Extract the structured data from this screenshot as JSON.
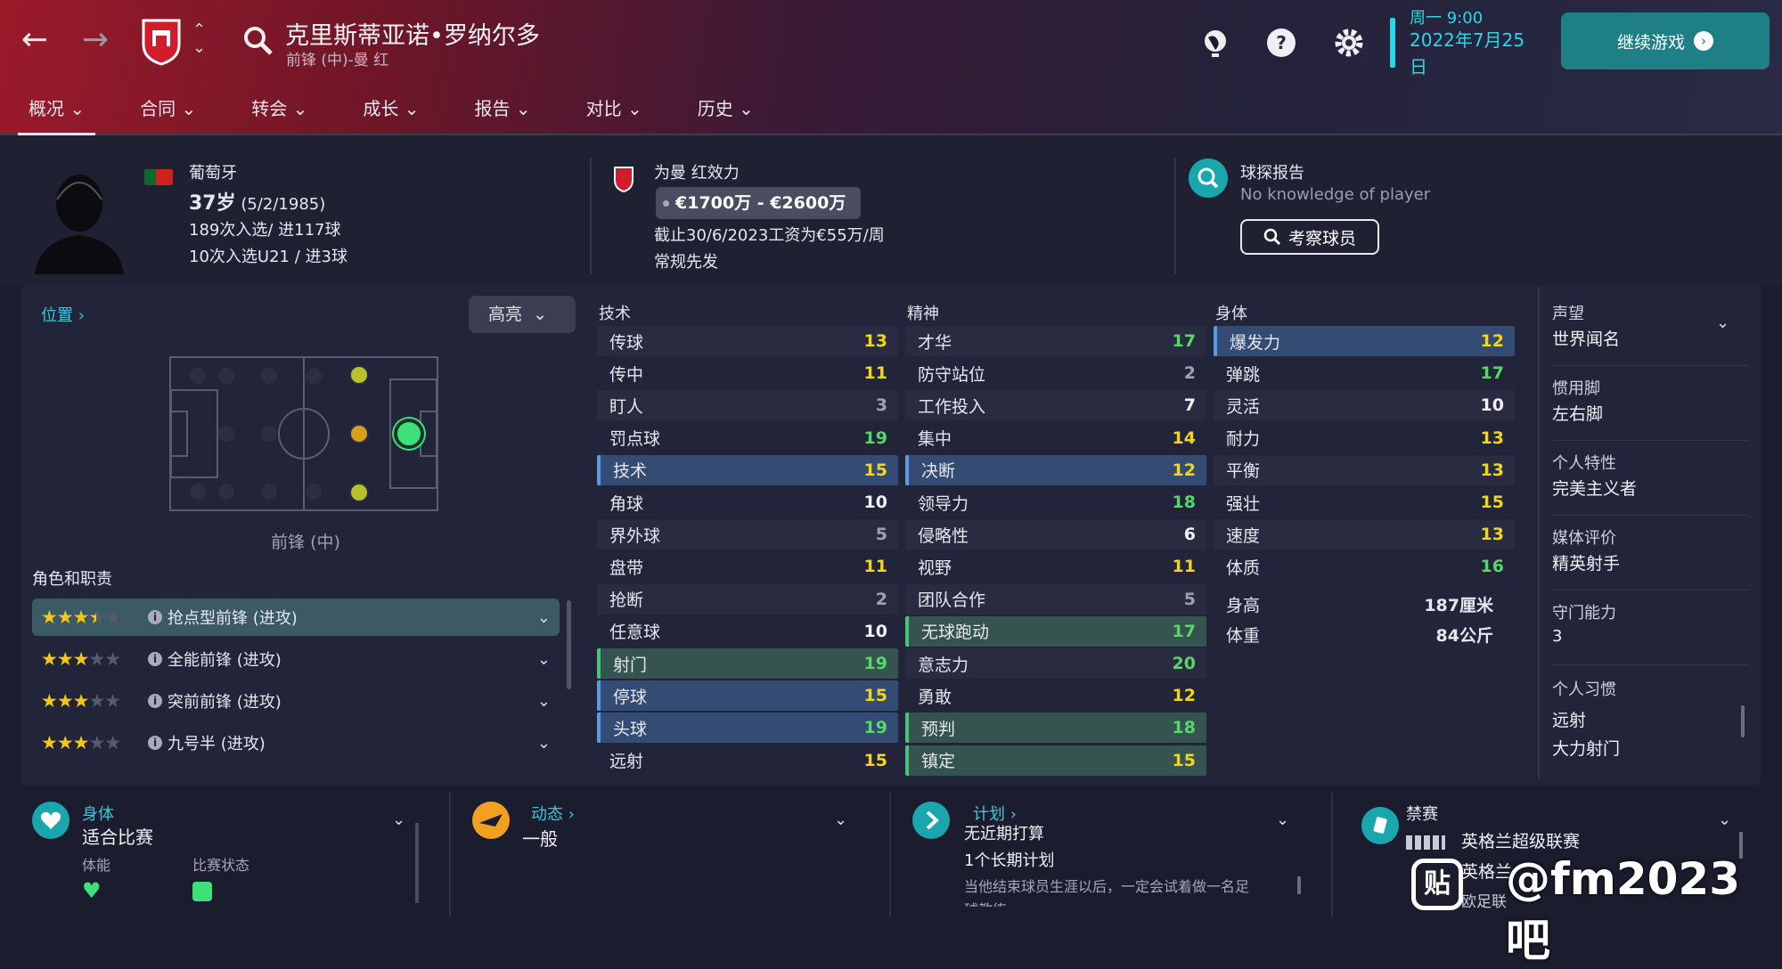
{
  "header": {
    "player_name": "克里斯蒂亚诺•罗纳尔多",
    "position_club": "前锋 (中)-曼 红",
    "weekday_time": "周一 9:00",
    "date": "2022年7月25日",
    "continue_label": "继续游戏",
    "tabs": [
      "概况",
      "合同",
      "转会",
      "成长",
      "报告",
      "对比",
      "历史"
    ]
  },
  "profile": {
    "nationality": "葡萄牙",
    "age": "37岁",
    "dob": "(5/2/1985)",
    "caps": "189次入选/ 进117球",
    "u21": "10次入选U21 / 进3球",
    "club_label": "为曼 红效力",
    "value": "€1700万 - €2600万",
    "contract": "截止30/6/2023工资为€55万/周",
    "squad_status": "常规先发",
    "scout_title": "球探报告",
    "scout_text": "No knowledge of player",
    "scout_button": "考察球员"
  },
  "position": {
    "link": "位置",
    "highlight": "高亮",
    "name": "前锋 (中)",
    "roles_title": "角色和职责",
    "roles": [
      {
        "stars": 3.5,
        "label": "抢点型前锋 (进攻)"
      },
      {
        "stars": 3,
        "label": "全能前锋 (进攻)"
      },
      {
        "stars": 3,
        "label": "突前前锋 (进攻)"
      },
      {
        "stars": 3,
        "label": "九号半 (进攻)"
      }
    ]
  },
  "attributes": {
    "technical_title": "技术",
    "mental_title": "精神",
    "physical_title": "身体",
    "technical": [
      {
        "n": "传球",
        "v": 13
      },
      {
        "n": "传中",
        "v": 11
      },
      {
        "n": "盯人",
        "v": 3
      },
      {
        "n": "罚点球",
        "v": 19
      },
      {
        "n": "技术",
        "v": 15
      },
      {
        "n": "角球",
        "v": 10
      },
      {
        "n": "界外球",
        "v": 5
      },
      {
        "n": "盘带",
        "v": 11
      },
      {
        "n": "抢断",
        "v": 2
      },
      {
        "n": "任意球",
        "v": 10
      },
      {
        "n": "射门",
        "v": 19
      },
      {
        "n": "停球",
        "v": 15
      },
      {
        "n": "头球",
        "v": 19
      },
      {
        "n": "远射",
        "v": 15
      }
    ],
    "mental": [
      {
        "n": "才华",
        "v": 17
      },
      {
        "n": "防守站位",
        "v": 2
      },
      {
        "n": "工作投入",
        "v": 7
      },
      {
        "n": "集中",
        "v": 14
      },
      {
        "n": "决断",
        "v": 12
      },
      {
        "n": "领导力",
        "v": 18
      },
      {
        "n": "侵略性",
        "v": 6
      },
      {
        "n": "视野",
        "v": 11
      },
      {
        "n": "团队合作",
        "v": 5
      },
      {
        "n": "无球跑动",
        "v": 17
      },
      {
        "n": "意志力",
        "v": 20
      },
      {
        "n": "勇敢",
        "v": 12
      },
      {
        "n": "预判",
        "v": 18
      },
      {
        "n": "镇定",
        "v": 15
      }
    ],
    "physical": [
      {
        "n": "爆发力",
        "v": 12
      },
      {
        "n": "弹跳",
        "v": 17
      },
      {
        "n": "灵活",
        "v": 10
      },
      {
        "n": "耐力",
        "v": 13
      },
      {
        "n": "平衡",
        "v": 13
      },
      {
        "n": "强壮",
        "v": 15
      },
      {
        "n": "速度",
        "v": 13
      },
      {
        "n": "体质",
        "v": 16
      }
    ],
    "height_label": "身高",
    "height": "187厘米",
    "weight_label": "体重",
    "weight": "84公斤"
  },
  "side": {
    "reputation_label": "声望",
    "reputation": "世界闻名",
    "foot_label": "惯用脚",
    "foot": "左右脚",
    "personality_label": "个人特性",
    "personality": "完美主义者",
    "media_label": "媒体评价",
    "media": "精英射手",
    "gk_label": "守门能力",
    "gk": "3",
    "habits_label": "个人习惯",
    "habit1": "远射",
    "habit2": "大力射门"
  },
  "bottom": {
    "physical_link": "身体",
    "physical_val": "适合比赛",
    "fitness": "体能",
    "form": "比赛状态",
    "morale_link": "动态",
    "morale_val": "一般",
    "plans_link": "计划",
    "plans1": "无近期打算",
    "plans2": "1个长期计划",
    "plans3": "当他结束球员生涯以后，一定会试着做一名足",
    "plans4": "球教练",
    "ban_title": "禁赛",
    "ban1": "英格兰超级联赛",
    "ban2": "英格兰",
    "ban3": "欧足联",
    "watermark": "@fm2023吧"
  },
  "colors": {
    "accent": "#2bd6e6",
    "star": "#f3c61b",
    "high": "#56d869",
    "mid": "#f3d51a"
  }
}
